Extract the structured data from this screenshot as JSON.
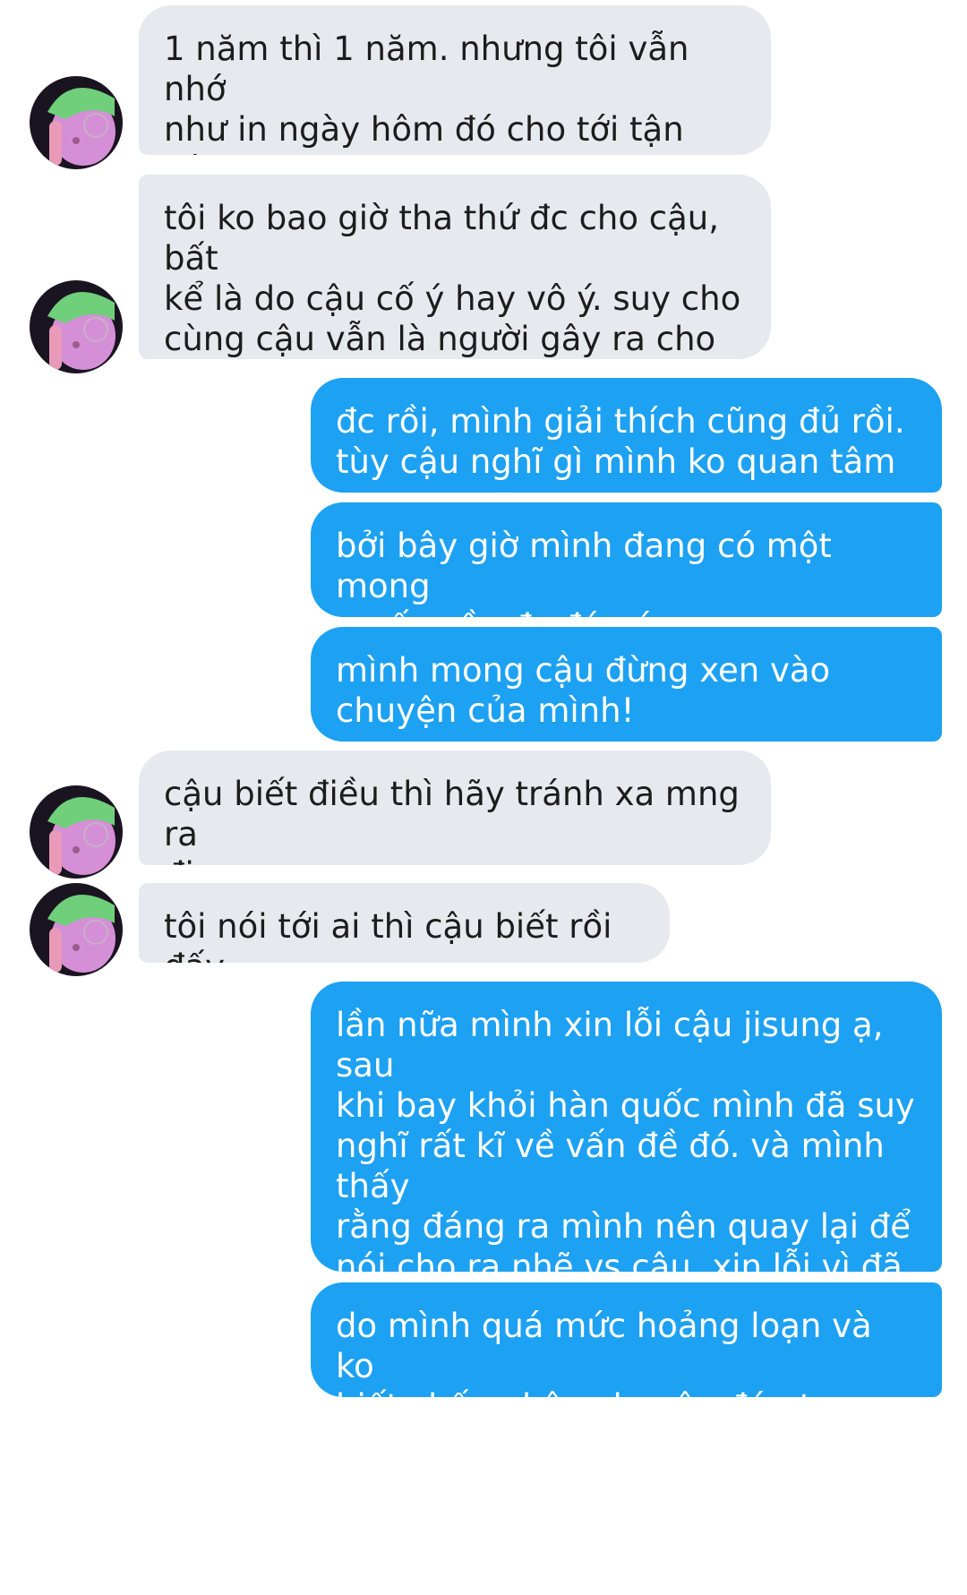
{
  "conversation": {
    "messages": [
      {
        "sender": "them",
        "text": "1 năm thì 1 năm. nhưng tôi vẫn nhớ\nnhư in ngày hôm đó cho tới tận hôm\nnay"
      },
      {
        "sender": "them",
        "text": "tôi ko bao giờ tha thứ đc cho cậu, bất\nkể là do cậu cố ý hay vô ý. suy cho\ncùng cậu vẫn là người gây ra cho tôi\nảnh hưởng từ ngày hôm đó"
      },
      {
        "sender": "me",
        "text": "đc rồi, mình giải thích cũng đủ rồi.\ntùy cậu nghĩ gì mình ko quan tâm"
      },
      {
        "sender": "me",
        "text": "bởi bây giờ mình đang có một mong\nmuốn cần đc đáp ứng,"
      },
      {
        "sender": "me",
        "text": "mình mong cậu đừng xen vào\nchuyện của mình!"
      },
      {
        "sender": "them",
        "text": "cậu biết điều thì hãy tránh xa mng ra\nđi"
      },
      {
        "sender": "them",
        "text": "tôi nói tới ai thì cậu biết rồi đấy"
      },
      {
        "sender": "me",
        "text": "lần nữa mình xin lỗi cậu jisung ạ, sau\nkhi bay khỏi hàn quốc mình đã suy\nnghĩ rất kĩ về vấn đề đó. và mình thấy\nrằng đáng ra mình nên quay lại để\nnói cho ra nhẽ vs cậu, xin lỗi vì đã để\ncậu phải suy nghĩ đau đầu vì những\ngì mình gây ra"
      },
      {
        "sender": "me",
        "text": "do mình quá mức hoảng loạn và ko\nbiết chấp nhận chuyện đó ntn"
      }
    ]
  },
  "colors": {
    "incoming_bubble": "#e6e9ed",
    "outgoing_bubble": "#1da1f2",
    "incoming_text": "#1c1c1c",
    "outgoing_text": "#ffffff"
  },
  "icons": {
    "sender_avatar": "avatar-photo-icon"
  }
}
